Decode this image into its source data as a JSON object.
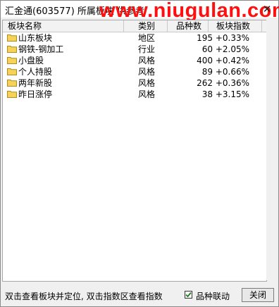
{
  "window": {
    "title": "汇金通(603577) 所属板块 供参考",
    "watermark": "www.niugulan.com",
    "close_glyph": "✕"
  },
  "table": {
    "columns": [
      "板块名称",
      "类别",
      "品种数",
      "板块指数"
    ],
    "rows": [
      {
        "name": "山东板块",
        "category": "地区",
        "count": "195",
        "index": "+0.33%"
      },
      {
        "name": "钢铁-钢加工",
        "category": "行业",
        "count": "60",
        "index": "+2.05%"
      },
      {
        "name": "小盘股",
        "category": "风格",
        "count": "400",
        "index": "+0.42%"
      },
      {
        "name": "个人持股",
        "category": "风格",
        "count": "89",
        "index": "+0.66%"
      },
      {
        "name": "两年新股",
        "category": "风格",
        "count": "262",
        "index": "+0.36%"
      },
      {
        "name": "昨日涨停",
        "category": "风格",
        "count": "38",
        "index": "+3.15%"
      }
    ]
  },
  "footer": {
    "hint": "双击查看板块并定位, 双击指数区查看指数",
    "checkbox_label": "品种联动",
    "checkbox_checked": true,
    "close_label": "关闭"
  },
  "colors": {
    "folder": "#f5d35a",
    "watermark": "#ff1010",
    "check": "#1a7f1a"
  }
}
